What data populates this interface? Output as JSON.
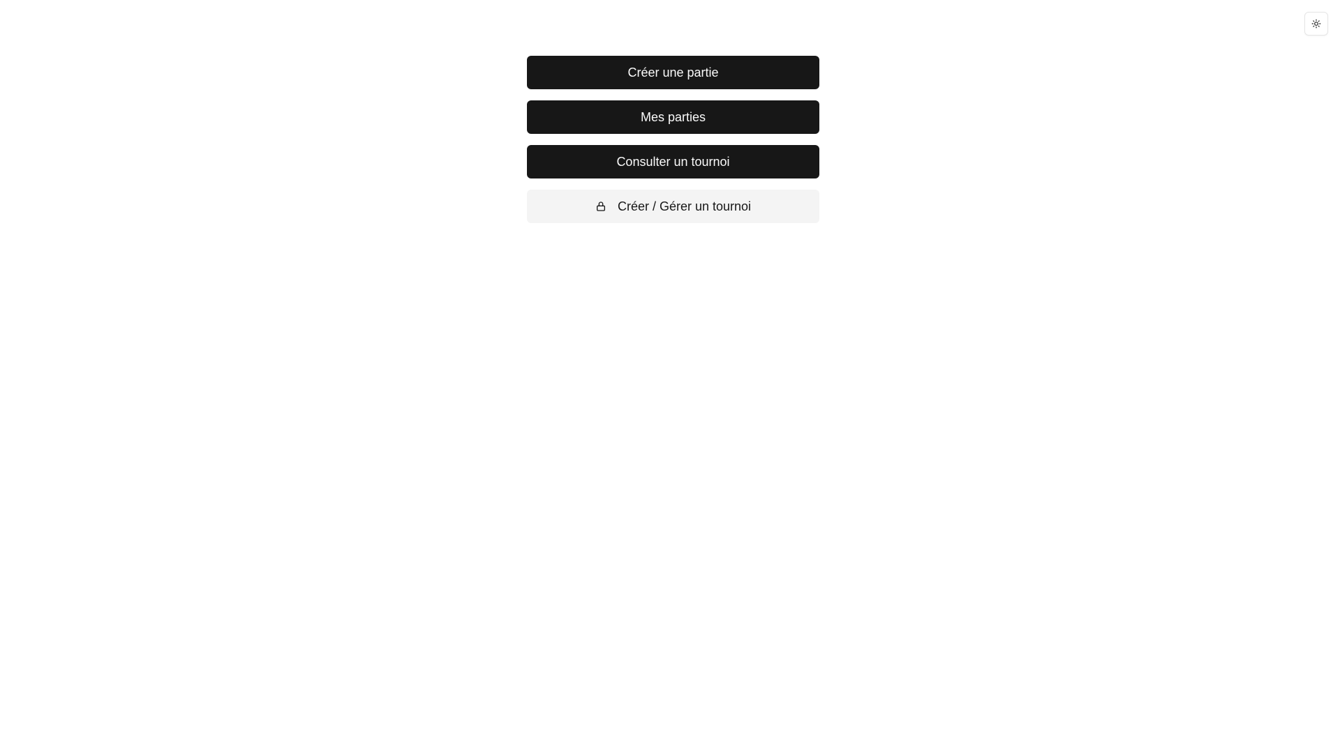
{
  "header": {
    "theme_toggle_icon": "sun-icon"
  },
  "menu": {
    "items": [
      {
        "label": "Créer une partie",
        "style": "primary"
      },
      {
        "label": "Mes parties",
        "style": "primary"
      },
      {
        "label": "Consulter un tournoi",
        "style": "primary"
      },
      {
        "label": "Créer / Gérer un tournoi",
        "style": "secondary",
        "icon": "lock-icon"
      }
    ]
  },
  "colors": {
    "primary_bg": "#171717",
    "primary_text": "#fafafa",
    "secondary_bg": "#f4f4f4",
    "secondary_text": "#171717"
  }
}
